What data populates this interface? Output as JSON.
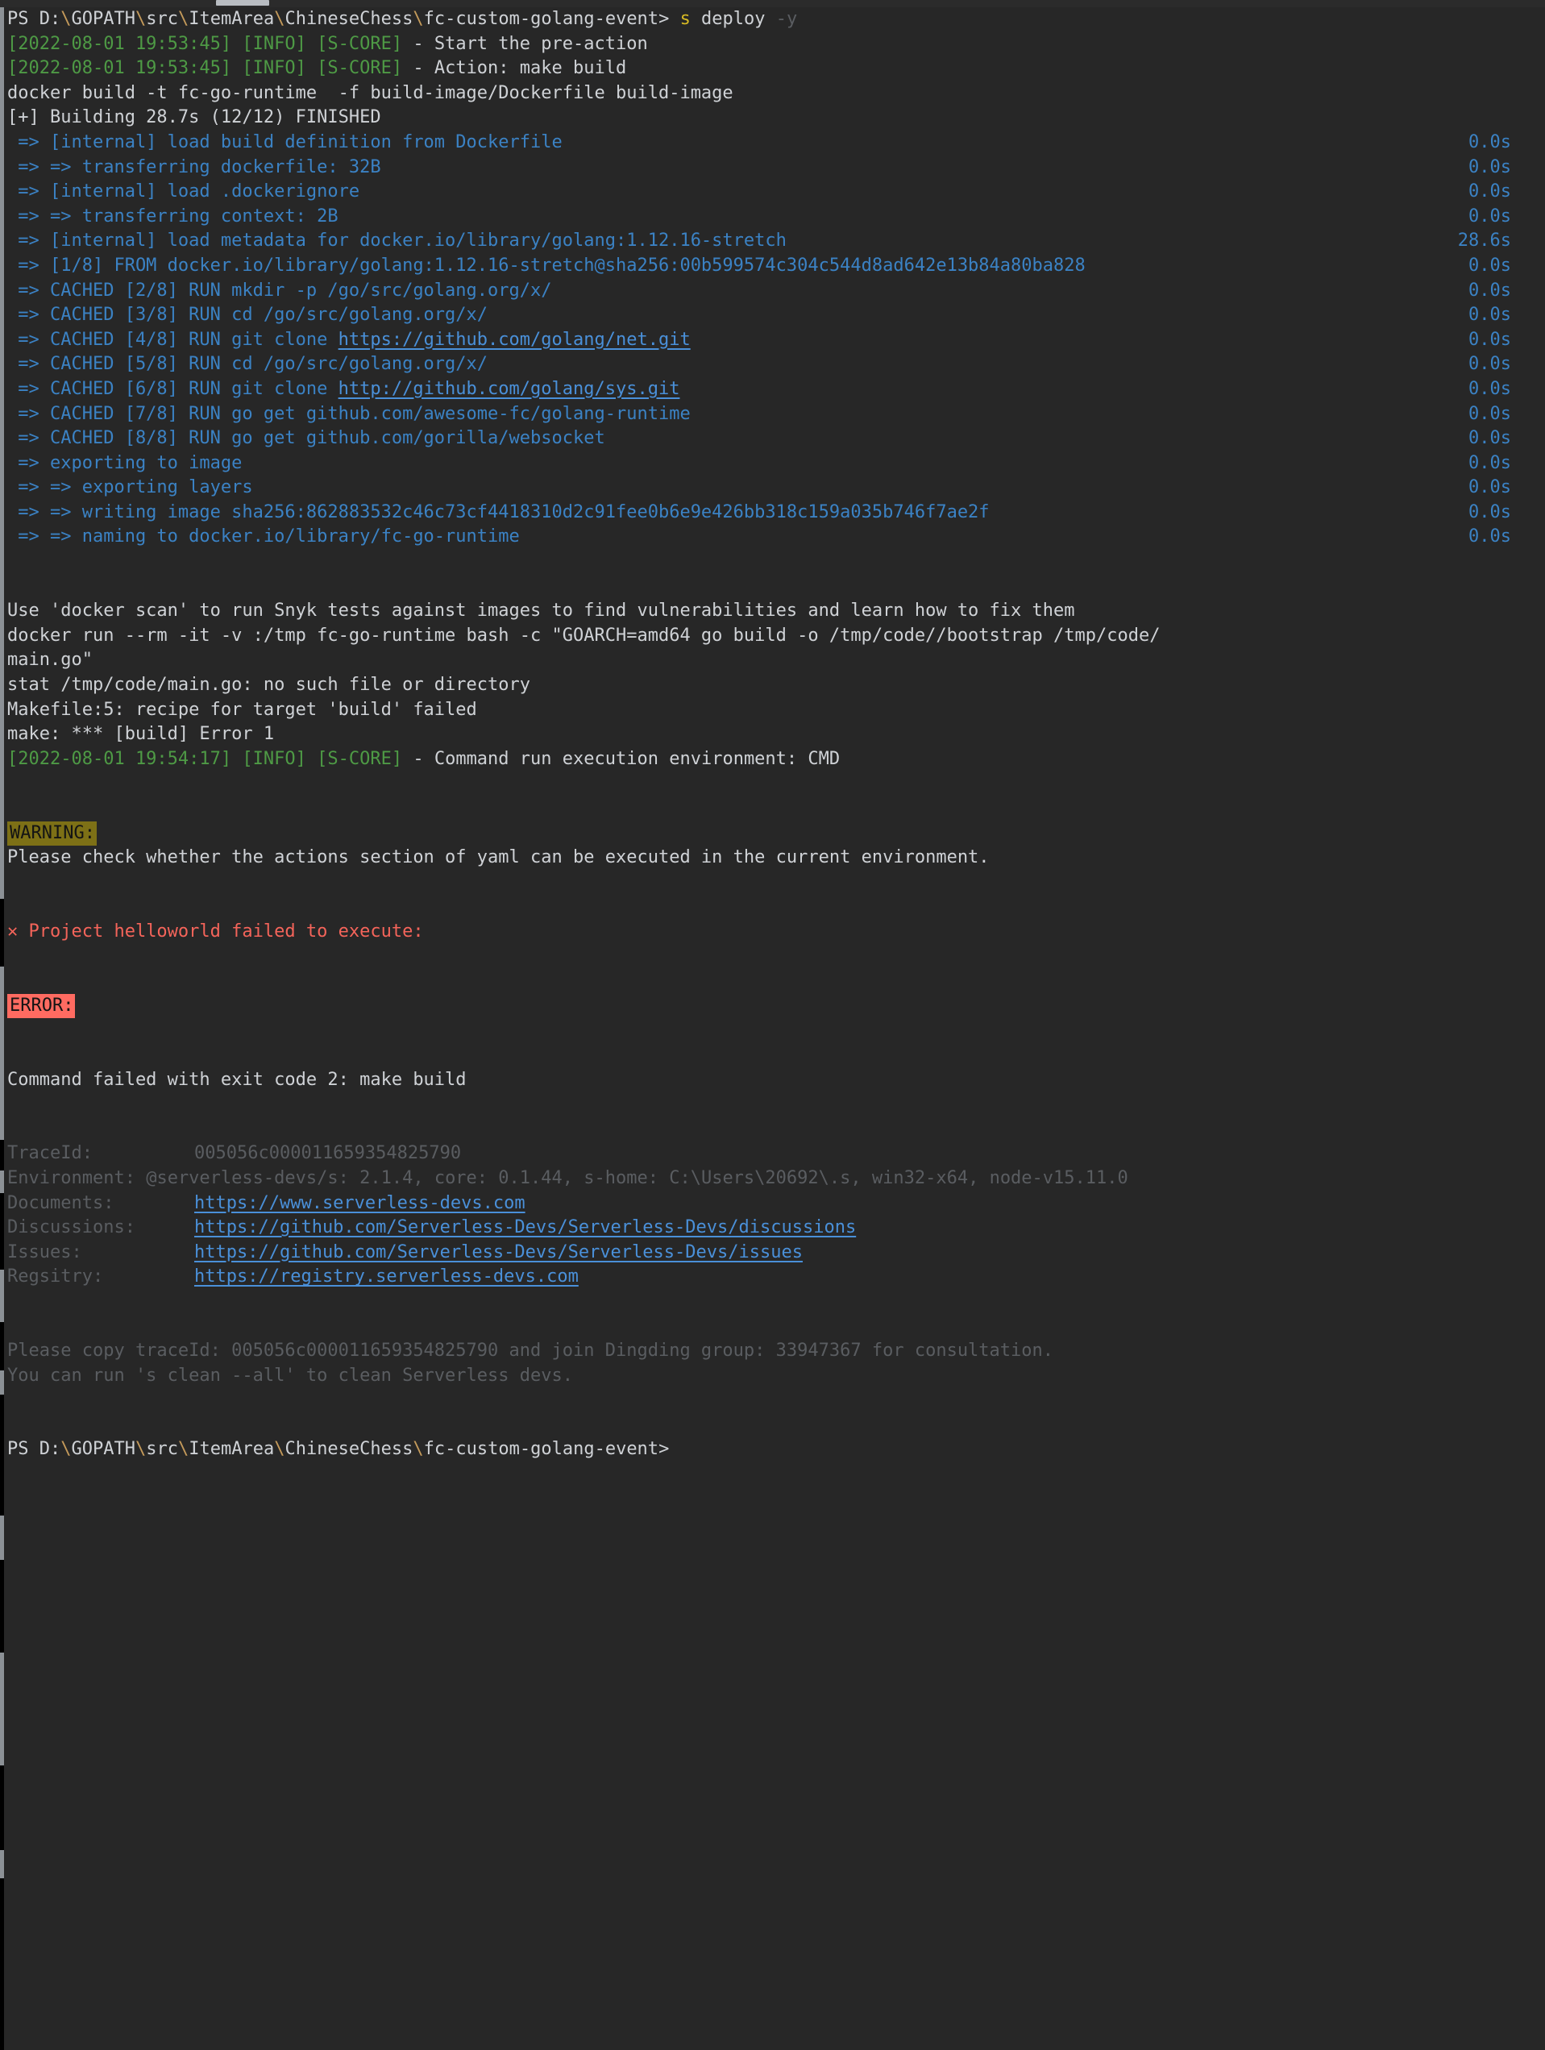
{
  "window": {
    "background_color": "#272727",
    "default_text_color": "#cfd2d6",
    "scrollbar": {
      "name": "horizontal-scrollbar",
      "thumb_color": "#b9bdc2"
    }
  },
  "colors": {
    "green": "#4e9a45",
    "blue": "#3b82c4",
    "link_blue": "#4a90d9",
    "yellow": "#d7ba23",
    "dim_gray": "#5a5d61",
    "red": "#f4645a",
    "warning_badge_bg": "#7d7016",
    "error_badge_bg": "#ff6b61",
    "path_separator": "#c49a5a"
  },
  "prompt_top": {
    "ps": "PS ",
    "drive": "D:",
    "path_parts": [
      "GOPATH",
      "src",
      "ItemArea",
      "ChineseChess",
      "fc-custom-golang-event"
    ],
    "caret": "> ",
    "command_name": "s",
    "command_args": " deploy ",
    "command_flag": "-y"
  },
  "log_lines": [
    {
      "type": "score",
      "timestamp": "[2022-08-01 19:53:45]",
      "level": "[INFO]",
      "source": "[S-CORE]",
      "message": " - Start the pre-action"
    },
    {
      "type": "score",
      "timestamp": "[2022-08-01 19:53:45]",
      "level": "[INFO]",
      "source": "[S-CORE]",
      "message": " - Action: make build"
    }
  ],
  "docker_command": "docker build -t fc-go-runtime  -f build-image/Dockerfile build-image",
  "build_header": "[+] Building 28.7s (12/12) FINISHED",
  "build_steps": [
    {
      "text": " => [internal] load build definition from Dockerfile",
      "time": "0.0s"
    },
    {
      "text": " => => transferring dockerfile: 32B",
      "time": "0.0s"
    },
    {
      "text": " => [internal] load .dockerignore",
      "time": "0.0s"
    },
    {
      "text": " => => transferring context: 2B",
      "time": "0.0s"
    },
    {
      "text": " => [internal] load metadata for docker.io/library/golang:1.12.16-stretch",
      "time": "28.6s"
    },
    {
      "text": " => [1/8] FROM docker.io/library/golang:1.12.16-stretch@sha256:00b599574c304c544d8ad642e13b84a80ba828",
      "time": "0.0s"
    },
    {
      "text": " => CACHED [2/8] RUN mkdir -p /go/src/golang.org/x/",
      "time": "0.0s"
    },
    {
      "text": " => CACHED [3/8] RUN cd /go/src/golang.org/x/",
      "time": "0.0s"
    },
    {
      "prefix": " => CACHED [4/8] RUN git clone ",
      "link": "https://github.com/golang/net.git",
      "time": "0.0s"
    },
    {
      "text": " => CACHED [5/8] RUN cd /go/src/golang.org/x/",
      "time": "0.0s"
    },
    {
      "prefix": " => CACHED [6/8] RUN git clone ",
      "link": "http://github.com/golang/sys.git",
      "time": "0.0s"
    },
    {
      "text": " => CACHED [7/8] RUN go get github.com/awesome-fc/golang-runtime",
      "time": "0.0s"
    },
    {
      "text": " => CACHED [8/8] RUN go get github.com/gorilla/websocket",
      "time": "0.0s"
    },
    {
      "text": " => exporting to image",
      "time": "0.0s"
    },
    {
      "text": " => => exporting layers",
      "time": "0.0s"
    },
    {
      "text": " => => writing image sha256:862883532c46c73cf4418310d2c91fee0b6e9e426bb318c159a035b746f7ae2f",
      "time": "0.0s"
    },
    {
      "text": " => => naming to docker.io/library/fc-go-runtime",
      "time": "0.0s"
    }
  ],
  "post_build": {
    "snyk_hint": "Use 'docker scan' to run Snyk tests against images to find vulnerabilities and learn how to fix them",
    "docker_run_line1": "docker run --rm -it -v :/tmp fc-go-runtime bash -c \"GOARCH=amd64 go build -o /tmp/code//bootstrap /tmp/code/",
    "docker_run_line2": "main.go\"",
    "stat_error": "stat /tmp/code/main.go: no such file or directory",
    "makefile_error": "Makefile:5: recipe for target 'build' failed",
    "make_error": "make: *** [build] Error 1"
  },
  "final_log": {
    "timestamp": "[2022-08-01 19:54:17]",
    "level": "[INFO]",
    "source": "[S-CORE]",
    "message": " - Command run execution environment: CMD"
  },
  "warning": {
    "badge": "WARNING:",
    "text": "Please check whether the actions section of yaml can be executed in the current environment."
  },
  "failure": {
    "icon": "✕",
    "text": " Project helloworld failed to execute:"
  },
  "error": {
    "badge": "ERROR:",
    "message": "Command failed with exit code 2: make build"
  },
  "footer": {
    "rows": [
      {
        "label": "TraceId:",
        "value": "005056c000011659354825790",
        "is_link": false
      },
      {
        "label": "Environment:",
        "value": "@serverless-devs/s: 2.1.4, core: 0.1.44, s-home: C:\\Users\\20692\\.s, win32-x64, node-v15.11.0",
        "is_link": false
      },
      {
        "label": "Documents:",
        "value": "https://www.serverless-devs.com",
        "is_link": true
      },
      {
        "label": "Discussions:",
        "value": "https://github.com/Serverless-Devs/Serverless-Devs/discussions",
        "is_link": true
      },
      {
        "label": "Issues:",
        "value": "https://github.com/Serverless-Devs/Serverless-Devs/issues",
        "is_link": true
      },
      {
        "label": "Regsitry:",
        "value": "https://registry.serverless-devs.com",
        "is_link": true
      }
    ],
    "hint1": "Please copy traceId: 005056c000011659354825790 and join Dingding group: 33947367 for consultation.",
    "hint2": "You can run 's clean --all' to clean Serverless devs."
  },
  "prompt_bottom": {
    "ps": "PS ",
    "drive": "D:",
    "path_parts": [
      "GOPATH",
      "src",
      "ItemArea",
      "ChineseChess",
      "fc-custom-golang-event"
    ],
    "caret": ">"
  }
}
